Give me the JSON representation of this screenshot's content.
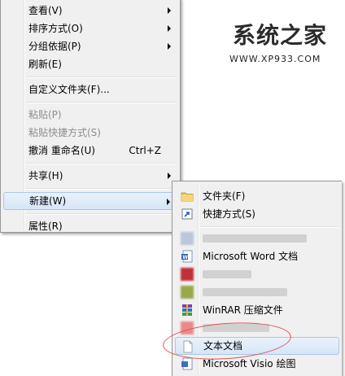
{
  "context_menu": {
    "items": [
      {
        "label": "查看(V)",
        "submenu": true
      },
      {
        "label": "排序方式(O)",
        "submenu": true
      },
      {
        "label": "分组依据(P)",
        "submenu": true
      },
      {
        "label": "刷新(E)"
      },
      {
        "label": "自定义文件夹(F)..."
      },
      {
        "label": "粘贴(P)",
        "disabled": true
      },
      {
        "label": "粘贴快捷方式(S)",
        "disabled": true
      },
      {
        "label": "撤消 重命名(U)",
        "shortcut": "Ctrl+Z"
      },
      {
        "label": "共享(H)",
        "submenu": true
      },
      {
        "label": "新建(W)",
        "submenu": true,
        "highlighted": true
      },
      {
        "label": "属性(R)"
      }
    ]
  },
  "new_submenu": {
    "items": [
      {
        "label": "文件夹(F)",
        "icon": "folder-icon"
      },
      {
        "label": "快捷方式(S)",
        "icon": "shortcut-icon"
      },
      {
        "label": "",
        "icon": "blurred-app-icon",
        "blurred": true
      },
      {
        "label": "Microsoft Word 文档",
        "icon": "word-document-icon"
      },
      {
        "label": "",
        "icon": "blurred-app-icon",
        "blurred": true
      },
      {
        "label": "",
        "icon": "blurred-app-icon",
        "blurred": true
      },
      {
        "label": "WinRAR 压缩文件",
        "icon": "winrar-icon"
      },
      {
        "label": "",
        "icon": "blurred-app-icon",
        "blurred": true
      },
      {
        "label": "文本文档",
        "icon": "text-document-icon",
        "hover": true
      },
      {
        "label": "Microsoft Visio 绘图",
        "icon": "visio-drawing-icon"
      }
    ]
  },
  "watermark": {
    "logo_text": "系统之家",
    "url": "WWW.XP933.COM"
  },
  "colors": {
    "menu_bg": "#f0f0f0",
    "highlight_border": "#a8c6ea",
    "annotation_red": "#e05050"
  }
}
